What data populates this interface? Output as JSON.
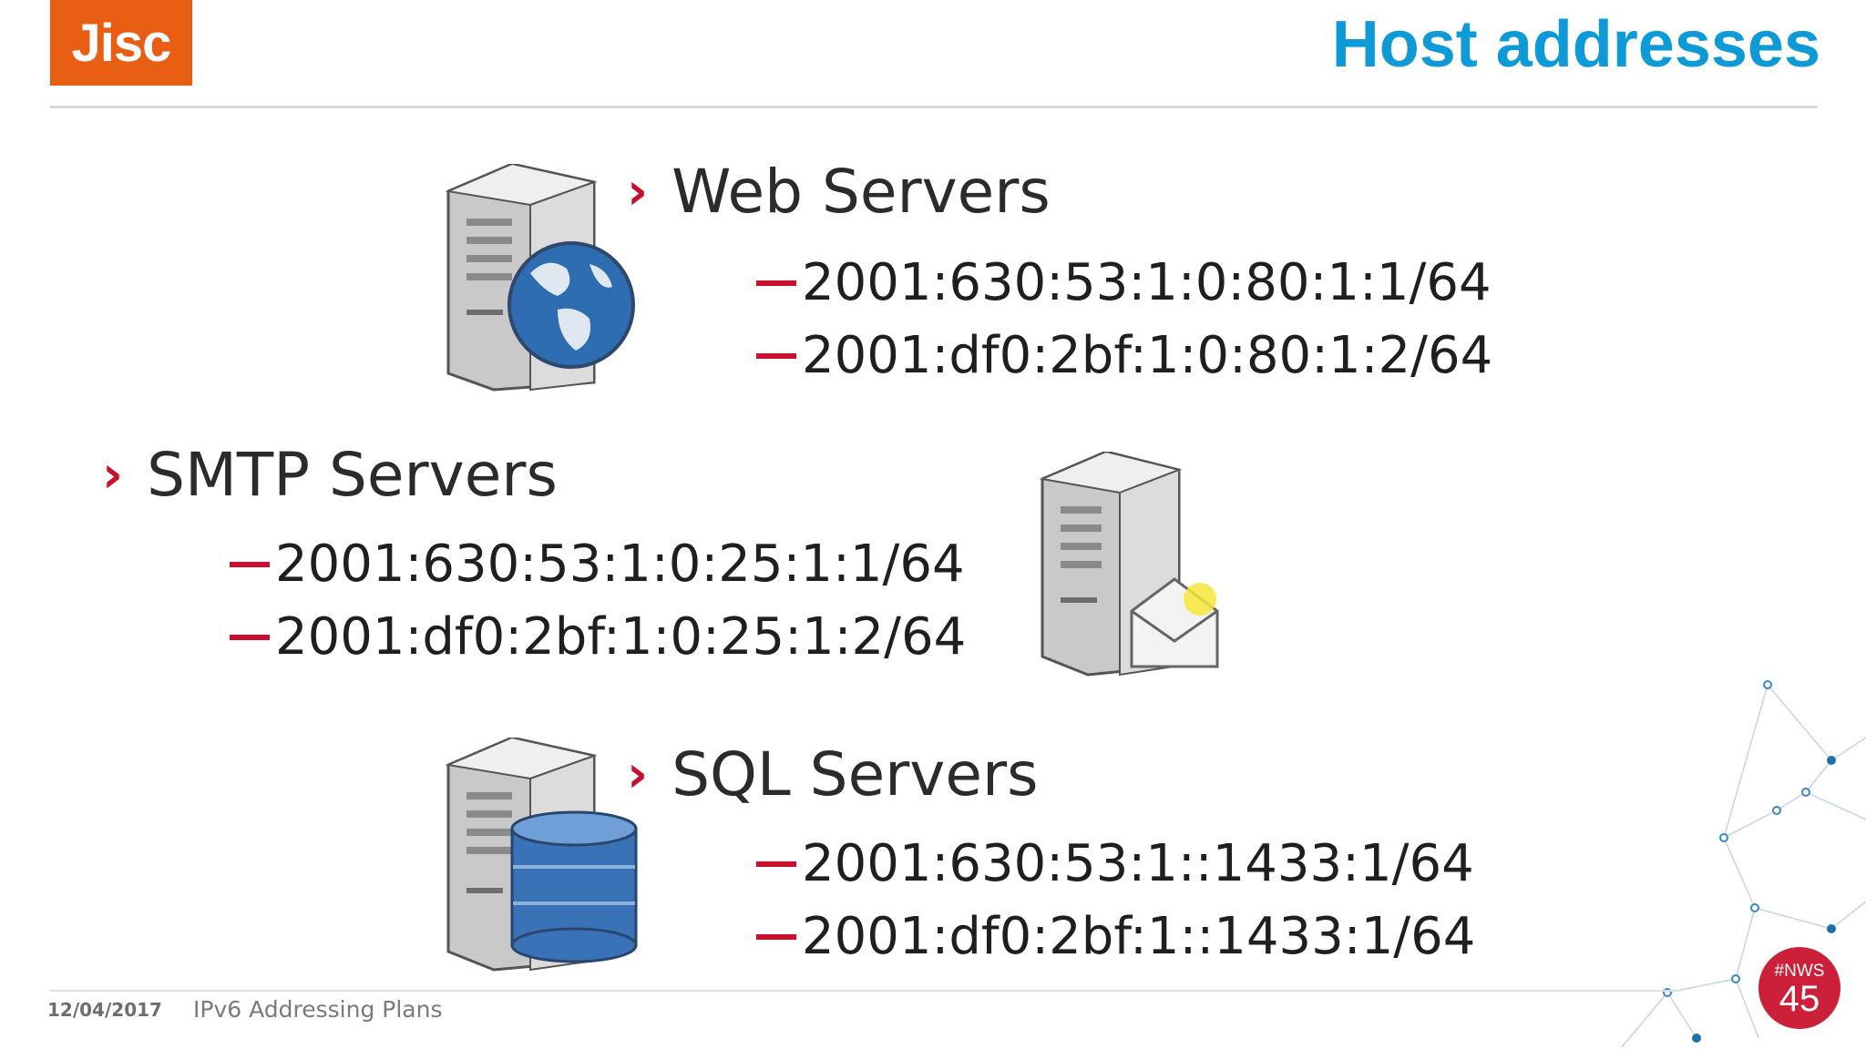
{
  "header": {
    "logo_text": "Jisc",
    "title": "Host addresses"
  },
  "sections": [
    {
      "heading": "Web Servers",
      "icon": "web-server-globe-icon",
      "addresses": [
        "2001:630:53:1:0:80:1:1/64",
        "2001:df0:2bf:1:0:80:1:2/64"
      ]
    },
    {
      "heading": "SMTP Servers",
      "icon": "mail-server-icon",
      "addresses": [
        "2001:630:53:1:0:25:1:1/64",
        "2001:df0:2bf:1:0:25:1:2/64"
      ]
    },
    {
      "heading": "SQL Servers",
      "icon": "database-server-icon",
      "addresses": [
        "2001:630:53:1::1433:1/64",
        "2001:df0:2bf:1::1433:1/64"
      ]
    }
  ],
  "footer": {
    "date": "12/04/2017",
    "title": "IPv6 Addressing Plans",
    "badge_top": "#NWS",
    "badge_bottom": "45"
  },
  "colors": {
    "logo": "#e85e13",
    "title": "#0e9ad7",
    "bullet": "#c8102e",
    "badge": "#cc1f3a"
  }
}
